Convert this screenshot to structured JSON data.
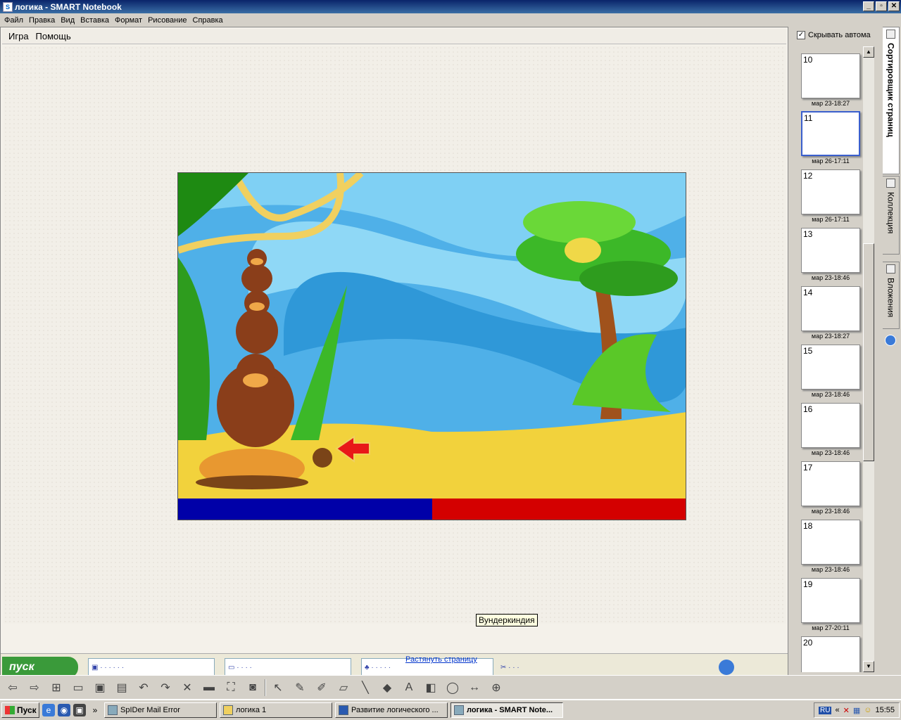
{
  "window": {
    "title": "логика - SMART Notebook",
    "buttons": [
      "_",
      "▫",
      "✕"
    ]
  },
  "menubar": [
    "Файл",
    "Правка",
    "Вид",
    "Вставка",
    "Формат",
    "Рисование",
    "Справка"
  ],
  "game_menu": [
    "Игра",
    "Помощь"
  ],
  "inner_taskbar": {
    "start": "пуск",
    "tooltip": "Вундеркиндия"
  },
  "stretch_link": "Растянуть страницу",
  "sidebar": {
    "autohide_label": "Скрывать автома",
    "tabs": [
      "Сортировщик страниц",
      "Коллекция",
      "Вложения"
    ],
    "pages": [
      {
        "num": "10",
        "date": "мар 23-18:27"
      },
      {
        "num": "11",
        "date": "мар 26-17:11"
      },
      {
        "num": "12",
        "date": "мар 26-17:11"
      },
      {
        "num": "13",
        "date": "мар 23-18:46"
      },
      {
        "num": "14",
        "date": "мар 23-18:27"
      },
      {
        "num": "15",
        "date": "мар 23-18:46"
      },
      {
        "num": "16",
        "date": "мар 23-18:46"
      },
      {
        "num": "17",
        "date": "мар 23-18:46"
      },
      {
        "num": "18",
        "date": "мар 23-18:46"
      },
      {
        "num": "19",
        "date": "мар 27-20:11"
      },
      {
        "num": "20",
        "date": ""
      }
    ],
    "active_page": "11"
  },
  "taskbar": {
    "start": "Пуск",
    "tasks": [
      {
        "label": "SpIDer Mail Error",
        "active": false
      },
      {
        "label": "логика 1",
        "active": false
      },
      {
        "label": "Развитие логического ...",
        "active": false
      },
      {
        "label": "логика - SMART Note...",
        "active": true
      }
    ],
    "tray": {
      "lang": "RU",
      "clock": "15:55"
    }
  },
  "colors": {
    "blue_bar": "#0000a8",
    "red_bar": "#d40000",
    "sky": "#4fb0e8",
    "sand": "#f2d23c"
  }
}
